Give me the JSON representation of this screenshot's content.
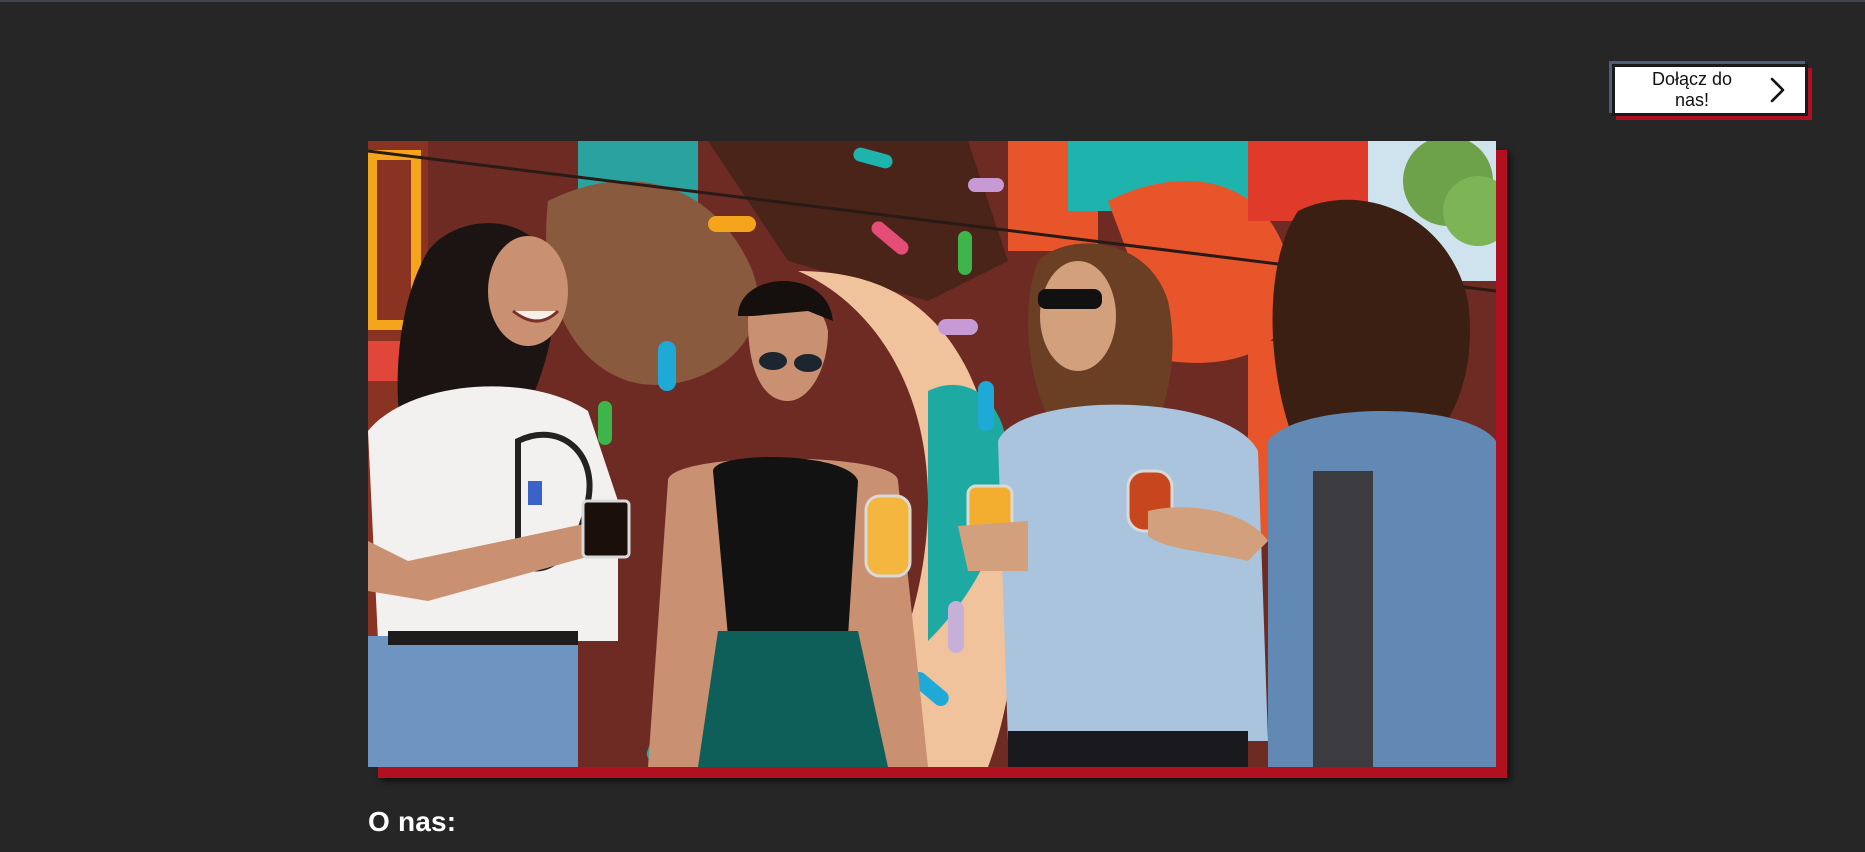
{
  "header": {
    "join_button": {
      "label": "Dołącz do nas!",
      "icon": "chevron-right-icon"
    }
  },
  "hero": {
    "image": "photo-four-women-laughing-holding-beer-glasses-in-front-of-colorful-mural",
    "frame_accent_color": "#b0101f"
  },
  "about": {
    "heading": "O nas:"
  },
  "colors": {
    "background": "#262626",
    "accent_red": "#b0101f",
    "button_bg": "#ffffff",
    "heading_text": "#ffffff"
  }
}
